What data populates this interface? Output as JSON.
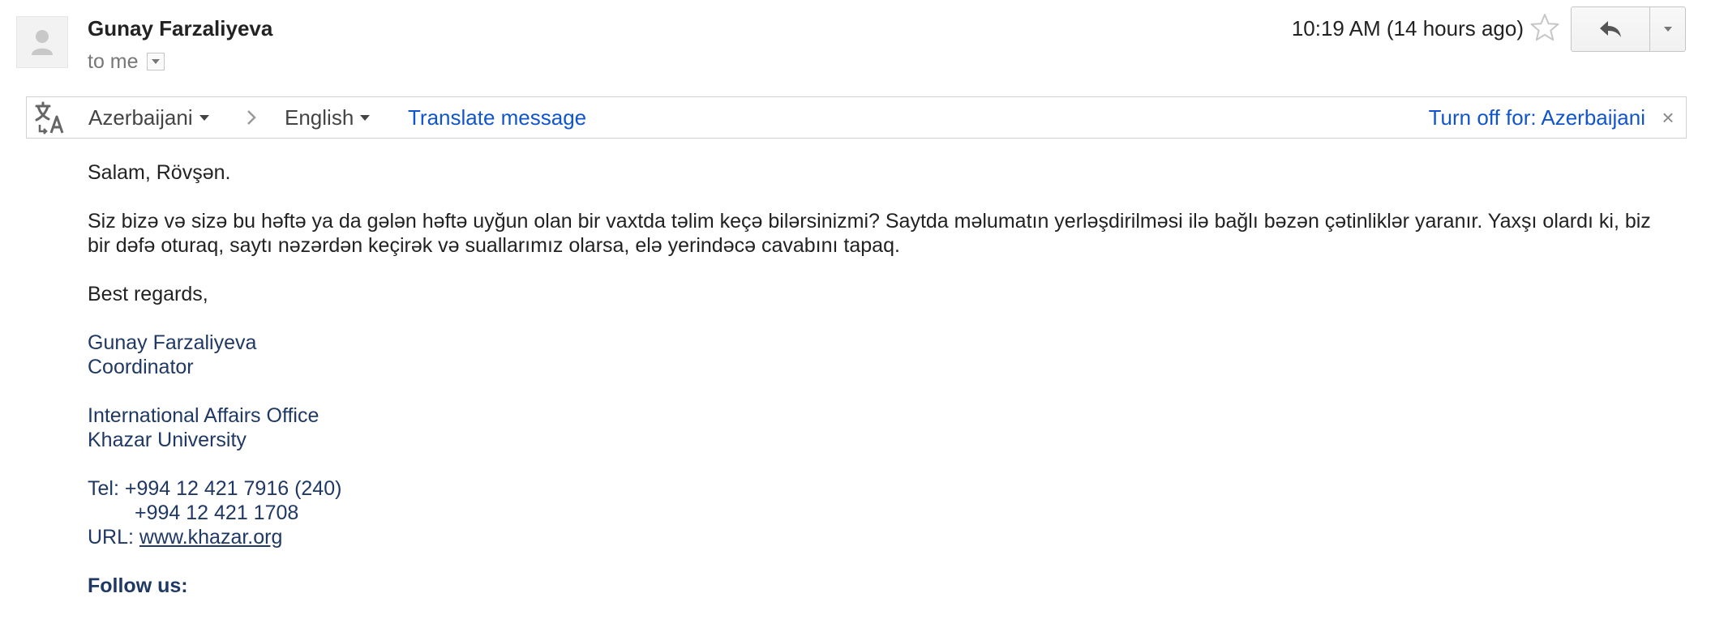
{
  "header": {
    "sender_name": "Gunay Farzaliyeva",
    "recipient_label": "to me",
    "timestamp": "10:19 AM (14 hours ago)",
    "avatar_icon": "default-avatar-icon",
    "star_icon": "star-outline-icon",
    "reply_icon": "reply-arrow-icon",
    "more_icon": "chevron-down-icon"
  },
  "translate_bar": {
    "icon": "translate-icon",
    "source_language": "Azerbaijani",
    "target_language": "English",
    "translate_label": "Translate message",
    "turn_off_label": "Turn off for: Azerbaijani",
    "close_label": "×",
    "link_color": "#1155cc"
  },
  "message": {
    "greeting": "Salam, Rövşən.",
    "paragraph": "Siz bizə və sizə bu həftə ya da gələn həftə uyğun olan bir vaxtda təlim keçə bilərsinizmi? Saytda məlumatın yerləşdirilməsi ilə bağlı bəzən çətinliklər yaranır. Yaxşı olardı ki, biz bir dəfə oturaq, saytı nəzərdən keçirək və suallarımız olarsa, elə yerindəcə cavabını tapaq.",
    "closing": "Best regards,"
  },
  "signature": {
    "name": "Gunay Farzaliyeva",
    "title": "Coordinator",
    "office": "International Affairs Office",
    "university": "Khazar University",
    "tel_line_1": "Tel: +994 12 421 7916 (240)",
    "tel_line_2": "+994 12 421 1708",
    "url_label": "URL: ",
    "url_link": "www.khazar.org",
    "follow_label": "Follow us:",
    "color": "#1f3864"
  }
}
